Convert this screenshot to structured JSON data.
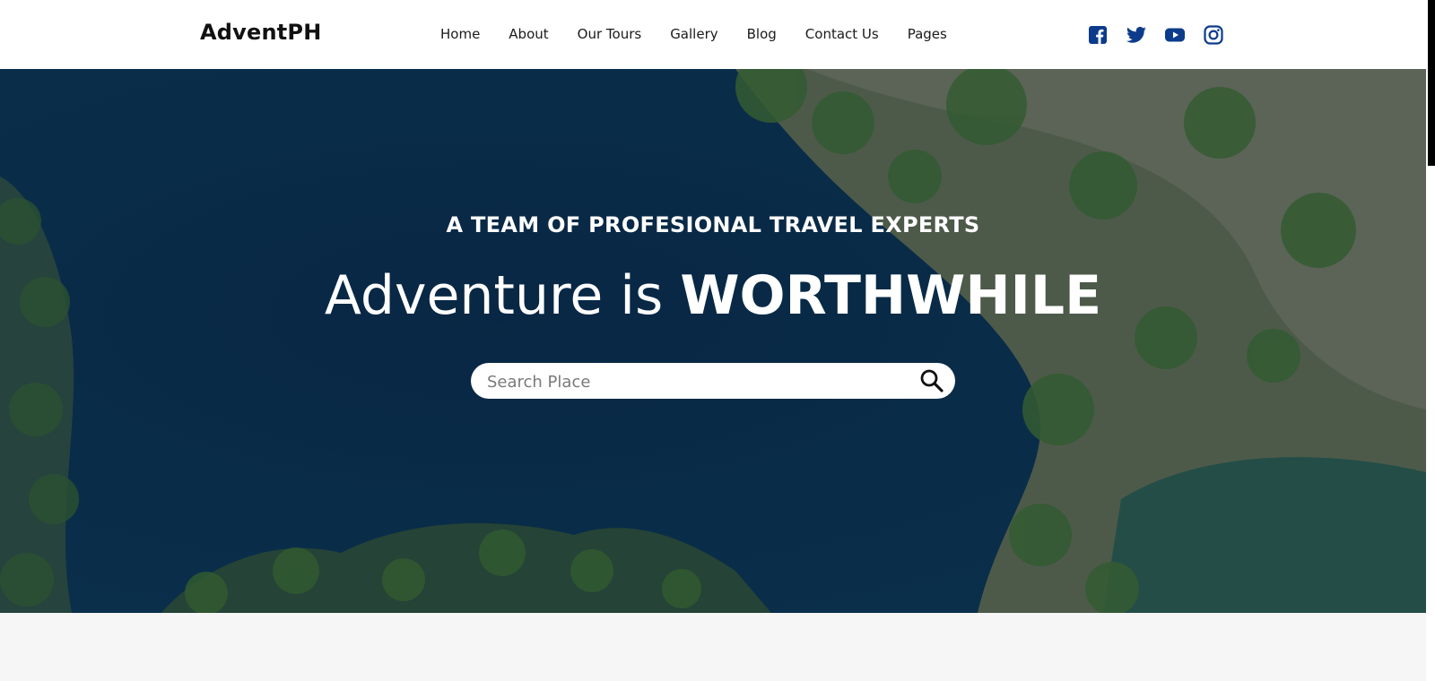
{
  "brand": {
    "name": "AdventPH"
  },
  "nav": {
    "items": [
      {
        "label": "Home"
      },
      {
        "label": "About"
      },
      {
        "label": "Our Tours"
      },
      {
        "label": "Gallery"
      },
      {
        "label": "Blog"
      },
      {
        "label": "Contact Us"
      },
      {
        "label": "Pages"
      }
    ]
  },
  "social": {
    "icons": [
      "facebook-icon",
      "twitter-icon",
      "youtube-icon",
      "instagram-icon"
    ],
    "color": "#0d3b8c"
  },
  "hero": {
    "tagline": "A TEAM OF PROFESIONAL TRAVEL EXPERTS",
    "headline_light": "Adventure is ",
    "headline_bold": "WORTHWHILE",
    "search": {
      "placeholder": "Search Place",
      "value": ""
    }
  },
  "colors": {
    "text_dark": "#111111",
    "hero_text": "#ffffff",
    "page_bg": "#f6f6f6"
  }
}
